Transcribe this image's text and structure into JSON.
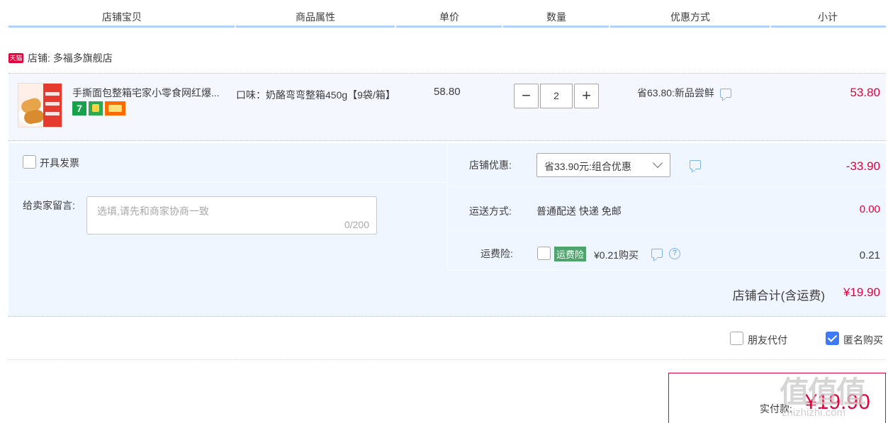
{
  "header": {
    "columns": [
      "店铺宝贝",
      "商品属性",
      "单价",
      "数量",
      "优惠方式",
      "小计"
    ]
  },
  "shop": {
    "badge": "天猫",
    "label": "店铺: 多福多旗舰店",
    "badge_color": "#e4003a"
  },
  "item": {
    "title": "手撕面包整箱宅家小零食网红爆...",
    "attr": "口味：奶酪弯弯整箱450g【9袋/箱】",
    "unit_price": "58.80",
    "quantity": "2",
    "minus": "−",
    "plus": "+",
    "promo": "省63.80:新品尝鲜",
    "subtotal": "53.80",
    "badge_7": "7"
  },
  "invoice": {
    "label": "开具发票"
  },
  "memo": {
    "label": "给卖家留言:",
    "placeholder": "选填,请先和商家协商一致",
    "counter": "0/200"
  },
  "shop_discount": {
    "label": "店铺优惠:",
    "selected": "省33.90元:组合优惠",
    "value": "-33.90"
  },
  "shipping": {
    "label": "运送方式:",
    "method": "普通配送 快递 免邮",
    "value": "0.00"
  },
  "insurance": {
    "label": "运费险:",
    "tag": "运费险",
    "price": "¥0.21购买",
    "value": "0.21",
    "help": "?",
    "tag_color": "#4fa36d"
  },
  "shop_total": {
    "label": "店铺合计(含运费)",
    "value": "¥19.90"
  },
  "options": {
    "friend_pay": "朋友代付",
    "anonymous": "匿名购买"
  },
  "payment": {
    "label": "实付款:",
    "value": "¥19.90"
  },
  "watermark": {
    "text": "值值值",
    "sub": "zhizhizhi.com"
  },
  "colors": {
    "price_red": "#e4003a",
    "header_bar": "#b2d1ff",
    "panel_bg": "#f0f6ff",
    "check_blue": "#3e7af7"
  }
}
